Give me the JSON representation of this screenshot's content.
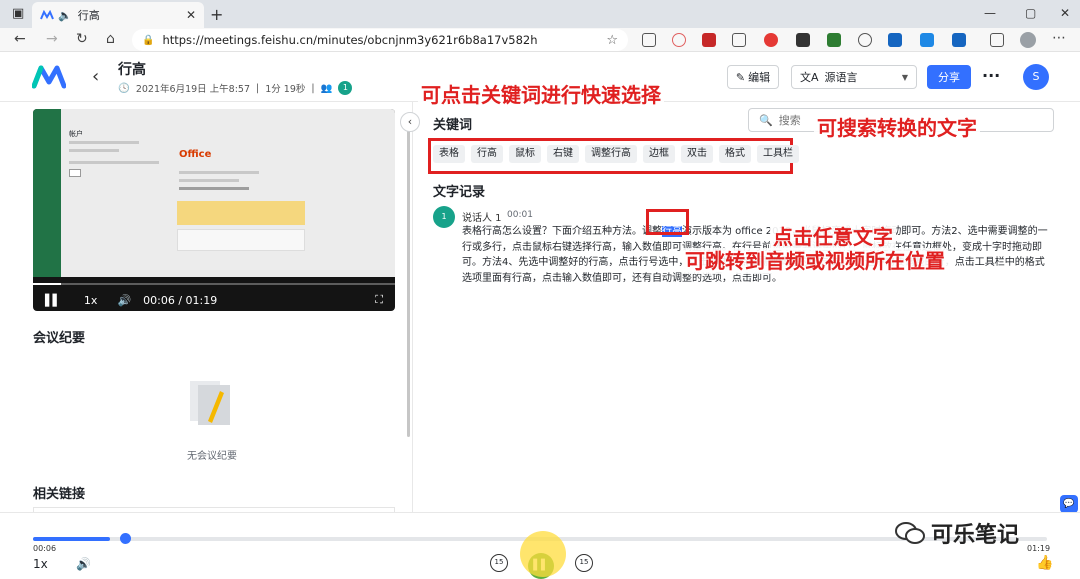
{
  "browser": {
    "tab_title": "行高",
    "url": "https://meetings.feishu.cn/minutes/obcnjnm3y621r6b8a17v582h"
  },
  "header": {
    "title": "行高",
    "date": "2021年6月19日 上午8:57",
    "duration": "1分 19秒",
    "participant_initial": "1",
    "edit_label": "编辑",
    "language_label": "源语言",
    "share_label": "分享",
    "user_initial": "S"
  },
  "video": {
    "speed": "1x",
    "time": "00:06 / 01:19",
    "progress": 0.076,
    "screen_account": "帐户",
    "screen_office": "Office"
  },
  "summary": {
    "title": "会议纪要",
    "empty": "无会议纪要"
  },
  "links": {
    "title": "相关链接"
  },
  "keywords": {
    "title": "关键词",
    "items": [
      "表格",
      "行高",
      "鼠标",
      "右键",
      "调整行高",
      "边框",
      "双击",
      "格式",
      "工具栏"
    ]
  },
  "search": {
    "placeholder": "搜索"
  },
  "transcript": {
    "title": "文字记录",
    "speaker_initial": "1",
    "speaker": "说话人 1",
    "time": "00:01",
    "text_before": "表格行高怎么设置？下面介绍五种方法。调整",
    "highlight": "行高",
    "text_after": "演示版本为 office 2019，当鼠标变成十字时拖动即可。方法2、选中需要调整的一行或多行，点击鼠标右键选择行高，输入数值即可调整行高。在行号前选中需要调整的行，鼠标放在任意边框处，变成十字时拖动即可。方法4、先选中调整好的行高，点击行号选中，点击格式刷点击需要调整的行方法。5、选中需要调整的行，点击工具栏中的格式选项里面有行高，点击输入数值即可，还有自动调整的选项，点击即可。"
  },
  "annotations": {
    "keywords": "可点击关键词进行快速选择",
    "search": "可搜索转换的文字",
    "click_text": "点击任意文字",
    "jump": "可跳转到音频或视频所在位置"
  },
  "player": {
    "current": "00:06",
    "total": "01:19",
    "speed": "1x",
    "skip_back": "15",
    "skip_forward": "15",
    "progress": 0.076
  },
  "watermark": {
    "text": "可乐笔记"
  },
  "colors": {
    "primary": "#3370ff",
    "annotation": "#e02020",
    "excel": "#217346",
    "speaker": "#17a28a"
  }
}
